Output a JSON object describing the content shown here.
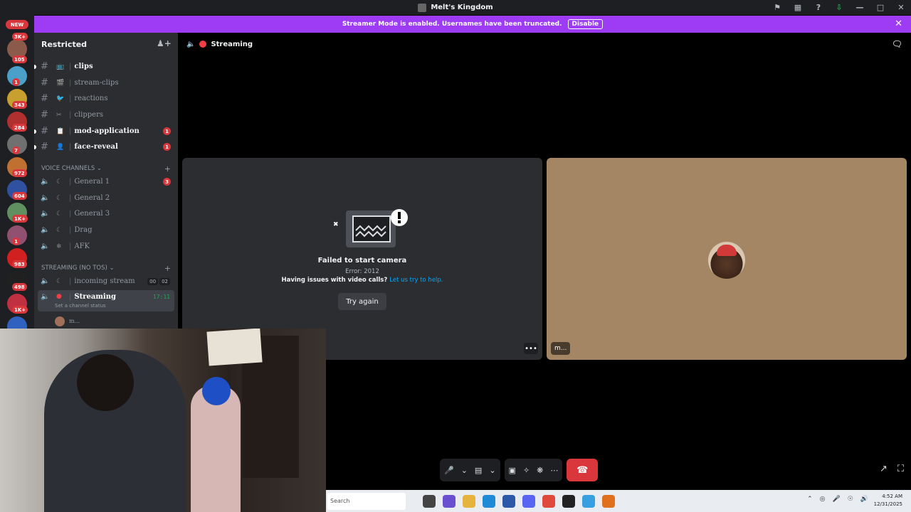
{
  "window": {
    "title": "Melt's Kingdom"
  },
  "banner": {
    "text": "Streamer Mode is enabled. Usernames have been truncated.",
    "disable_label": "Disable"
  },
  "rail": {
    "new_label": "NEW",
    "badges": [
      "3K+",
      "105",
      "1",
      "343",
      "284",
      "7",
      "972",
      "604",
      "1K+",
      "1",
      "983",
      "498",
      "1K+"
    ]
  },
  "sidebar": {
    "server_name": "Restricted",
    "text_channels": [
      {
        "name": "clips",
        "emoji": "📺",
        "bright": true,
        "mention": ""
      },
      {
        "name": "stream-clips",
        "emoji": "🎬",
        "bright": false,
        "mention": ""
      },
      {
        "name": "reactions",
        "emoji": "🐦",
        "bright": false,
        "mention": ""
      },
      {
        "name": "clippers",
        "emoji": "✂",
        "bright": false,
        "mention": ""
      },
      {
        "name": "mod-application",
        "emoji": "📋",
        "bright": true,
        "mention": "1"
      },
      {
        "name": "face-reveal",
        "emoji": "👤",
        "bright": true,
        "mention": "1"
      }
    ],
    "voice_category": "VOICE CHANNELS",
    "voice_channels": [
      {
        "name": "General 1",
        "mention": "3"
      },
      {
        "name": "General 2",
        "mention": ""
      },
      {
        "name": "General 3",
        "mention": ""
      },
      {
        "name": "Drag",
        "mention": ""
      },
      {
        "name": "AFK",
        "mention": ""
      }
    ],
    "streaming_category": "STREAMING (NO TOS)",
    "incoming_stream": {
      "name": "incoming stream",
      "count_a": "00",
      "count_b": "02"
    },
    "streaming_channel": {
      "name": "Streaming",
      "timer": "17:11",
      "status": "Set a channel status"
    },
    "member": {
      "name": "m..."
    }
  },
  "main": {
    "channel_title": "Streaming",
    "error_title": "Failed to start camera",
    "error_code": "Error: 2012",
    "help_text": "Having issues with video calls?",
    "help_link": "Let us try to help.",
    "try_again": "Try again",
    "more_label": "•••",
    "user_tag": "m..."
  },
  "taskbar": {
    "search_placeholder": "Search",
    "time": "4:52 AM",
    "date": "12/31/2025"
  },
  "colors": {
    "banner": "#9d3bf5",
    "end_call": "#da373c",
    "mention": "#da373c",
    "timer": "#23a55a"
  }
}
